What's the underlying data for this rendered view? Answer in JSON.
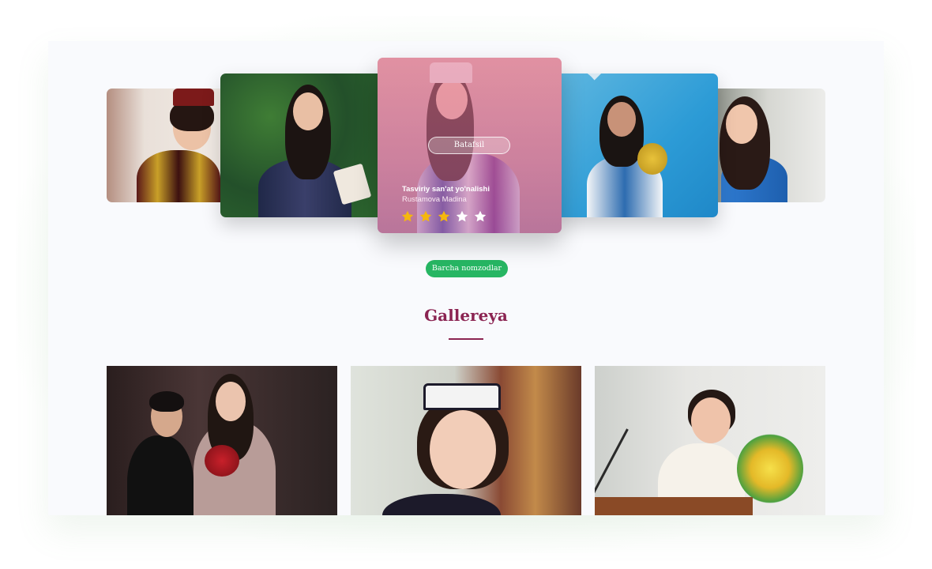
{
  "carousel": {
    "featured": {
      "details_button": "Batafsil",
      "category": "Tasviriy san'at yo'nalishi",
      "name": "Rustamova Madina",
      "rating": 3,
      "rating_max": 5
    }
  },
  "all_nominees_button": "Barcha nomzodlar",
  "gallery": {
    "title": "Gallereya"
  },
  "colors": {
    "accent_green": "#27b663",
    "title_maroon": "#8b2452",
    "star_filled": "#f5b70d",
    "star_empty": "#ffffff"
  }
}
